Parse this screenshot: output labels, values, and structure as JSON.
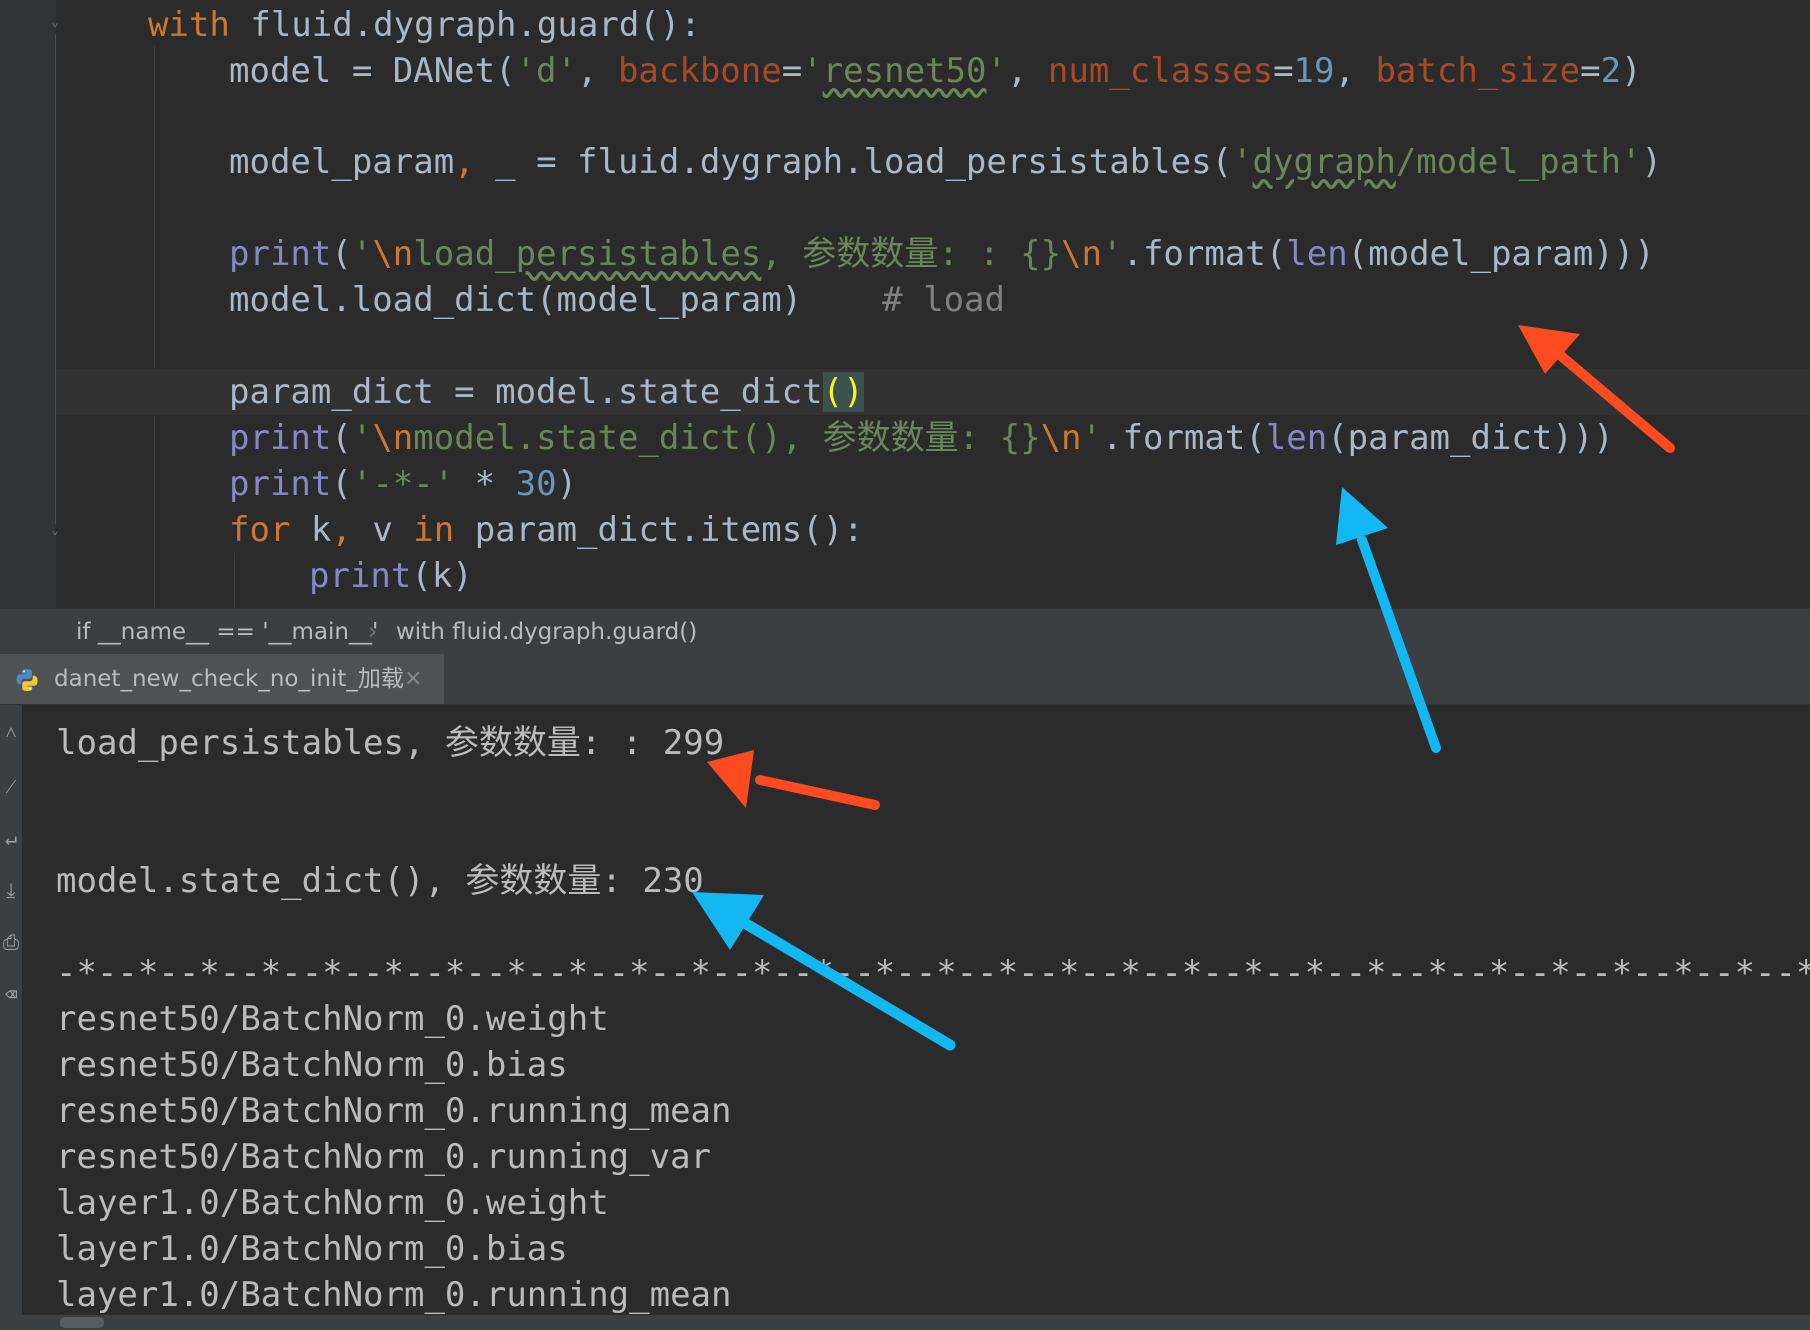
{
  "editor": {
    "lines": {
      "with_line": {
        "kw": "with",
        "rest": " fluid.dygraph.guard():"
      },
      "model_line": {
        "a": "model = DANet(",
        "s1": "'d'",
        "c1": ", ",
        "p1": "backbone",
        "eq1": "=",
        "s2a": "'",
        "s2b": "resnet50",
        "s2c": "'",
        "c2": ", ",
        "p2": "num_classes",
        "eq2": "=",
        "n1": "19",
        "c3": ", ",
        "p3": "batch_size",
        "eq3": "=",
        "n2": "2",
        "close": ")"
      },
      "load_line": {
        "a": "model_param",
        "c": ",",
        "b": " _ = fluid.dygraph.load_persistables(",
        "s1": "'",
        "s2": "dygraph",
        "s3": "/model_path'",
        "close": ")"
      },
      "print1_line": {
        "fn": "print",
        "open": "(",
        "q": "'",
        "esc": "\\n",
        "t1": "load_",
        "t2": "persistables",
        "t3": ", 参数数量: : {}",
        "esc2": "\\n",
        "q2": "'",
        "fmt": ".format(",
        "len": "len",
        "rest": "(model_param)))"
      },
      "load_dict_line": {
        "code": "model.load_dict(model_param)",
        "cmt": "# load"
      },
      "state_dict_line": {
        "code": "param_dict = model.state_dict",
        "parens": "()"
      },
      "print2_line": {
        "fn": "print",
        "open": "(",
        "q": "'",
        "esc": "\\n",
        "t1": "model.state_dict(), 参数数量: {}",
        "esc2": "\\n",
        "q2": "'",
        "fmt": ".format(",
        "len": "len",
        "rest": "(param_dict)))"
      },
      "print3_line": {
        "fn": "print",
        "open": "(",
        "s": "'-*-'",
        "op": " * ",
        "n": "30",
        "close": ")"
      },
      "for_line": {
        "kw1": "for",
        "mid1": " k",
        "c": ",",
        "mid2": " v ",
        "kw2": "in",
        "rest": " param_dict.items():"
      },
      "print4_line": {
        "fn": "print",
        "rest": "(k)"
      }
    }
  },
  "breadcrumb": {
    "item1": "if __name__ == '__main__'",
    "separator": "›",
    "item2": "with fluid.dygraph.guard()"
  },
  "run_tab": {
    "label": "danet_new_check_no_init_加载",
    "close": "×"
  },
  "console": {
    "lines": [
      "load_persistables, 参数数量: : 299",
      "",
      "",
      "model.state_dict(), 参数数量: 230",
      "",
      "-*--*--*--*--*--*--*--*--*--*--*--*--*--*--*--*--*--*--*--*--*--*--*--*--*--*--*--*--*--*-",
      "resnet50/BatchNorm_0.weight",
      "resnet50/BatchNorm_0.bias",
      "resnet50/BatchNorm_0.running_mean",
      "resnet50/BatchNorm_0.running_var",
      "layer1.0/BatchNorm_0.weight",
      "layer1.0/BatchNorm_0.bias",
      "layer1.0/BatchNorm_0.running_mean"
    ]
  },
  "icons": {
    "fold_top": "fold-marker-icon",
    "fold_bottom": "fold-marker-icon",
    "python": "python-file-icon",
    "toolbar": [
      "scroll-up-icon",
      "wrap-icon",
      "soft-wrap-icon",
      "scroll-to-end-icon",
      "print-icon",
      "trash-icon"
    ]
  },
  "colors": {
    "background": "#2b2b2b",
    "keyword": "#cc7832",
    "builtin": "#8888c6",
    "string": "#6a8759",
    "number": "#6897bb",
    "parameter": "#aa4926",
    "comment": "#808080",
    "arrow_red": "#fc4a21",
    "arrow_blue": "#13b8f3"
  }
}
